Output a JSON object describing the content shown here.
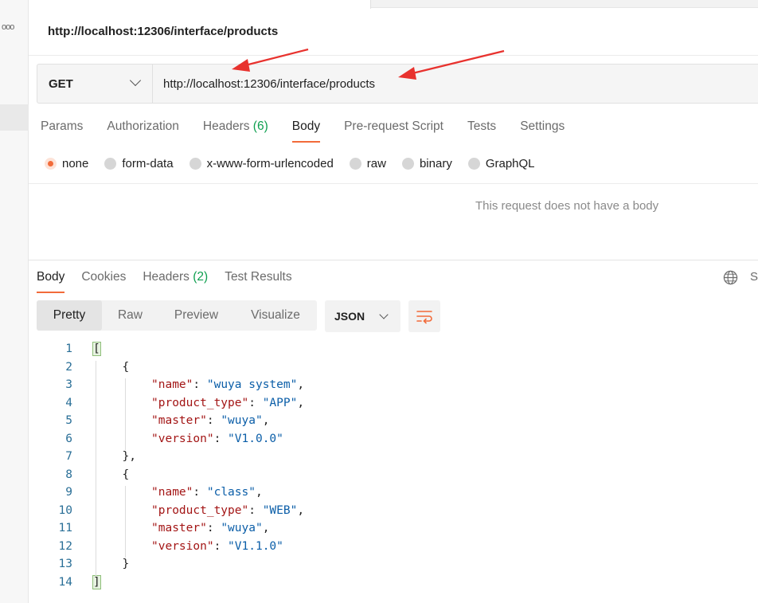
{
  "request": {
    "title": "http://localhost:12306/interface/products",
    "method": "GET",
    "url": "http://localhost:12306/interface/products"
  },
  "request_tabs": [
    {
      "label": "Params",
      "count": ""
    },
    {
      "label": "Authorization",
      "count": ""
    },
    {
      "label": "Headers",
      "count": "(6)"
    },
    {
      "label": "Body",
      "count": "",
      "active": true
    },
    {
      "label": "Pre-request Script",
      "count": ""
    },
    {
      "label": "Tests",
      "count": ""
    },
    {
      "label": "Settings",
      "count": ""
    }
  ],
  "body_types": [
    {
      "label": "none",
      "selected": true
    },
    {
      "label": "form-data",
      "selected": false
    },
    {
      "label": "x-www-form-urlencoded",
      "selected": false
    },
    {
      "label": "raw",
      "selected": false
    },
    {
      "label": "binary",
      "selected": false
    },
    {
      "label": "GraphQL",
      "selected": false
    }
  ],
  "empty_body_message": "This request does not have a body",
  "response_tabs": [
    {
      "label": "Body",
      "count": "",
      "active": true
    },
    {
      "label": "Cookies",
      "count": ""
    },
    {
      "label": "Headers",
      "count": "(2)"
    },
    {
      "label": "Test Results",
      "count": ""
    }
  ],
  "save_cut_label": "S",
  "view_modes": [
    {
      "label": "Pretty",
      "active": true
    },
    {
      "label": "Raw",
      "active": false
    },
    {
      "label": "Preview",
      "active": false
    },
    {
      "label": "Visualize",
      "active": false
    }
  ],
  "format": "JSON",
  "icons": {
    "method_dropdown": "chevron-down-icon",
    "format_dropdown": "chevron-down-icon",
    "wrap": "wrap-lines-icon",
    "globe": "globe-icon",
    "sidebar_more": "more-dots-icon"
  },
  "colors": {
    "accent": "#f26b3a",
    "count_green": "#0e9f4f",
    "json_key": "#a31515",
    "json_string": "#0b5ea8",
    "line_number": "#2a6f97",
    "annotation_arrow": "#e8322e"
  },
  "response_json": [
    {
      "name": "wuya system",
      "product_type": "APP",
      "master": "wuya",
      "version": "V1.0.0"
    },
    {
      "name": "class",
      "product_type": "WEB",
      "master": "wuya",
      "version": "V1.1.0"
    }
  ]
}
